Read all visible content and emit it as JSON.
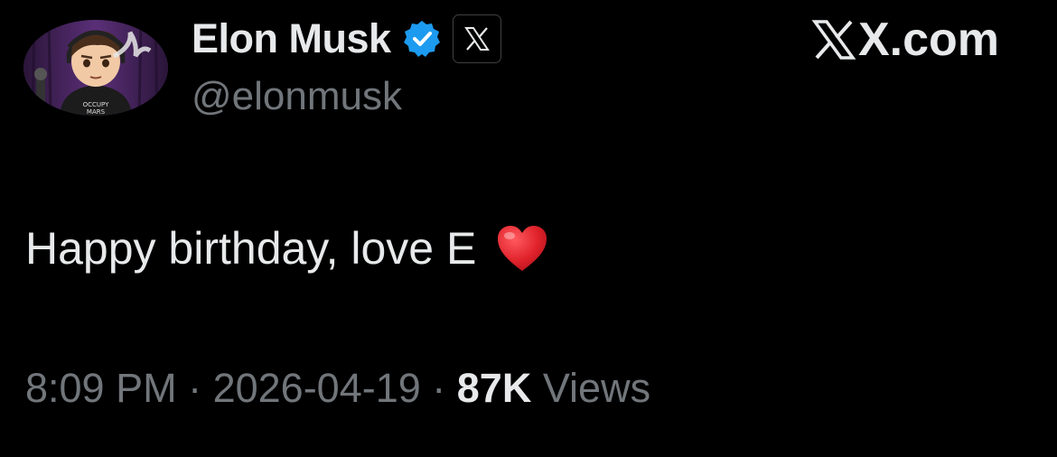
{
  "author": {
    "display_name": "Elon Musk",
    "handle": "@elonmusk",
    "verified_icon": "verified-badge-icon",
    "affiliate_icon": "x-logo-icon",
    "avatar": "avatar-image"
  },
  "brand": {
    "domain": "X.com",
    "icon": "x-logo-icon"
  },
  "tweet": {
    "text": "Happy birthday, love E",
    "emoji_icon": "red-heart-icon"
  },
  "meta": {
    "time": "8:09 PM",
    "separator": " · ",
    "date": "2026-04-19",
    "views_count": "87K",
    "views_label": "Views"
  },
  "colors": {
    "background": "#000000",
    "text_primary": "#e7e9ea",
    "text_secondary": "#71767b",
    "verified_blue": "#1d9bf0",
    "heart_red": "#e0222b"
  }
}
